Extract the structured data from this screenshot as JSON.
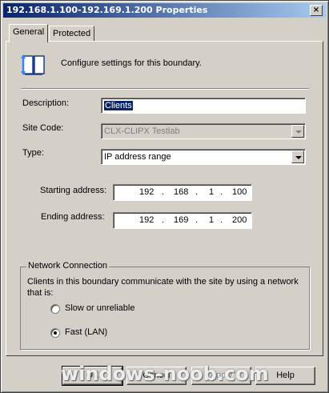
{
  "window": {
    "title": "192.168.1.100-192.169.1.200 Properties",
    "close_glyph": "×"
  },
  "tabs": [
    {
      "label": "General",
      "active": true
    },
    {
      "label": "Protected",
      "active": false
    }
  ],
  "header": {
    "icon": "book-icon",
    "text": "Configure settings for this boundary."
  },
  "form": {
    "description_label": "Description:",
    "description_value": "Clients",
    "site_code_label": "Site Code:",
    "site_code_value": "CLX-CLIPX Testlab",
    "type_label": "Type:",
    "type_value": "IP address range",
    "starting_label": "Starting address:",
    "starting_address": [
      "192",
      "168",
      "1",
      "100"
    ],
    "ending_label": "Ending address:",
    "ending_address": [
      "192",
      "169",
      "1",
      "200"
    ],
    "ip_separator": "."
  },
  "network": {
    "title": "Network Connection",
    "description": "Clients in this boundary communicate with the site by using a network that is:",
    "options": [
      {
        "label": "Slow or unreliable",
        "checked": false
      },
      {
        "label": "Fast (LAN)",
        "checked": true
      }
    ]
  },
  "buttons": {
    "ok": "OK",
    "cancel": "Cancel",
    "apply": "Apply",
    "help": "Help"
  },
  "watermark": "windows-noob.com",
  "colors": {
    "title_start": "#0a246a",
    "title_end": "#a6caf0",
    "face": "#d4d0c8",
    "selection": "#0a246a"
  }
}
